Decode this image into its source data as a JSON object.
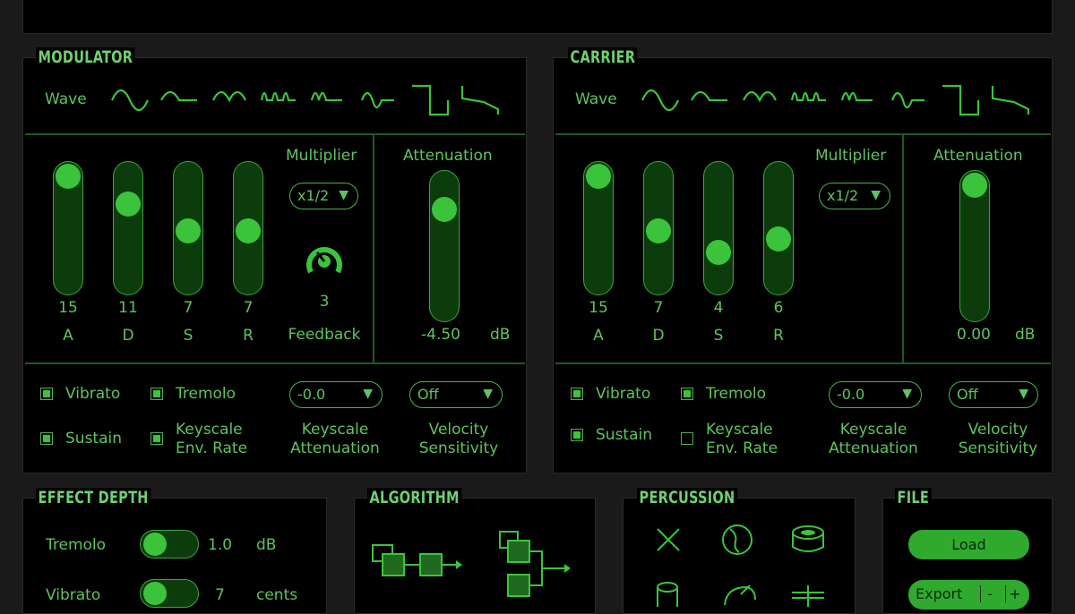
{
  "modulator": {
    "title": "MODULATOR",
    "wave_label": "Wave",
    "multiplier_label": "Multiplier",
    "multiplier_value": "x1/2",
    "feedback_value": "3",
    "feedback_label": "Feedback",
    "attenuation_label": "Attenuation",
    "attenuation_value": "-4.50",
    "attenuation_unit": "dB",
    "attenuation_level": 0.2,
    "envelope": [
      {
        "label": "A",
        "value": "15",
        "level": 1.0
      },
      {
        "label": "D",
        "value": "11",
        "level": 0.73
      },
      {
        "label": "S",
        "value": "7",
        "level": 0.47
      },
      {
        "label": "R",
        "value": "7",
        "level": 0.47
      }
    ],
    "vibrato_label": "Vibrato",
    "vibrato_checked": true,
    "tremolo_label": "Tremolo",
    "tremolo_checked": true,
    "sustain_label": "Sustain",
    "sustain_checked": true,
    "ksr_label_1": "Keyscale",
    "ksr_label_2": "Env. Rate",
    "ksr_checked": true,
    "ksl_value": "-0.0",
    "ksl_label_1": "Keyscale",
    "ksl_label_2": "Attenuation",
    "velocity_value": "Off",
    "velocity_label_1": "Velocity",
    "velocity_label_2": "Sensitivity"
  },
  "carrier": {
    "title": "CARRIER",
    "wave_label": "Wave",
    "multiplier_label": "Multiplier",
    "multiplier_value": "x1/2",
    "attenuation_label": "Attenuation",
    "attenuation_value": "0.00",
    "attenuation_unit": "dB",
    "attenuation_level": 0.0,
    "envelope": [
      {
        "label": "A",
        "value": "15",
        "level": 1.0
      },
      {
        "label": "D",
        "value": "7",
        "level": 0.47
      },
      {
        "label": "S",
        "value": "4",
        "level": 0.27
      },
      {
        "label": "R",
        "value": "6",
        "level": 0.4
      }
    ],
    "vibrato_label": "Vibrato",
    "vibrato_checked": true,
    "tremolo_label": "Tremolo",
    "tremolo_checked": true,
    "sustain_label": "Sustain",
    "sustain_checked": true,
    "ksr_label_1": "Keyscale",
    "ksr_label_2": "Env. Rate",
    "ksr_checked": false,
    "ksl_value": "-0.0",
    "ksl_label_1": "Keyscale",
    "ksl_label_2": "Attenuation",
    "velocity_value": "Off",
    "velocity_label_1": "Velocity",
    "velocity_label_2": "Sensitivity"
  },
  "effect_depth": {
    "title": "EFFECT DEPTH",
    "tremolo_label": "Tremolo",
    "tremolo_value": "1.0",
    "tremolo_unit": "dB",
    "vibrato_label": "Vibrato",
    "vibrato_value": "7",
    "vibrato_unit": "cents"
  },
  "algorithm": {
    "title": "ALGORITHM"
  },
  "percussion": {
    "title": "PERCUSSION"
  },
  "file": {
    "title": "FILE",
    "load_label": "Load",
    "export_label": "Export",
    "minus_label": "-",
    "plus_label": "+"
  },
  "colors": {
    "accent": "#3bc43b",
    "background": "#000000",
    "frame": "#1a1a1a"
  }
}
